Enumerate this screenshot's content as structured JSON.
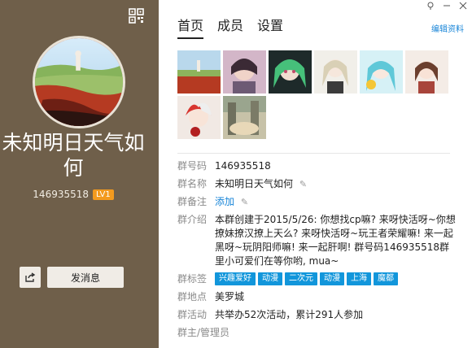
{
  "group": {
    "name": "未知明日天气如何",
    "number": "146935518",
    "level": "LV1"
  },
  "actions": {
    "send_message": "发消息"
  },
  "tabs": [
    "首页",
    "成员",
    "设置"
  ],
  "edit_profile": "编辑资料",
  "info": {
    "number_label": "群号码",
    "number_value": "146935518",
    "name_label": "群名称",
    "name_value": "未知明日天气如何",
    "remark_label": "群备注",
    "remark_value": "添加",
    "intro_label": "群介绍",
    "intro_value": "本群创建于2015/5/26: 你想找cp嘛? 来呀快活呀~你想撩妹撩汉撩上天么? 来呀快活呀~玩王者荣耀嘛! 来一起黑呀~玩阴阳师嘛! 来一起肝啊! 群号码146935518群里小可爱们在等你哟, mua~",
    "tags_label": "群标签",
    "tags": [
      "兴趣爱好",
      "动漫",
      "二次元",
      "动漫",
      "上海",
      "魔都"
    ],
    "location_label": "群地点",
    "location_value": "美罗城",
    "activity_label": "群活动",
    "activity_value": "共举办52次活动，累计291人参加",
    "admin_label": "群主/管理员"
  },
  "colors": {
    "left_bg": "#6f5f4a",
    "tag_blue": "#1296db",
    "link_blue": "#1a86d8",
    "level_badge": "#f39a1e"
  },
  "icons": [
    "qr-code-icon",
    "share-icon",
    "pin-icon",
    "minimize-icon",
    "close-icon",
    "pencil-icon"
  ]
}
